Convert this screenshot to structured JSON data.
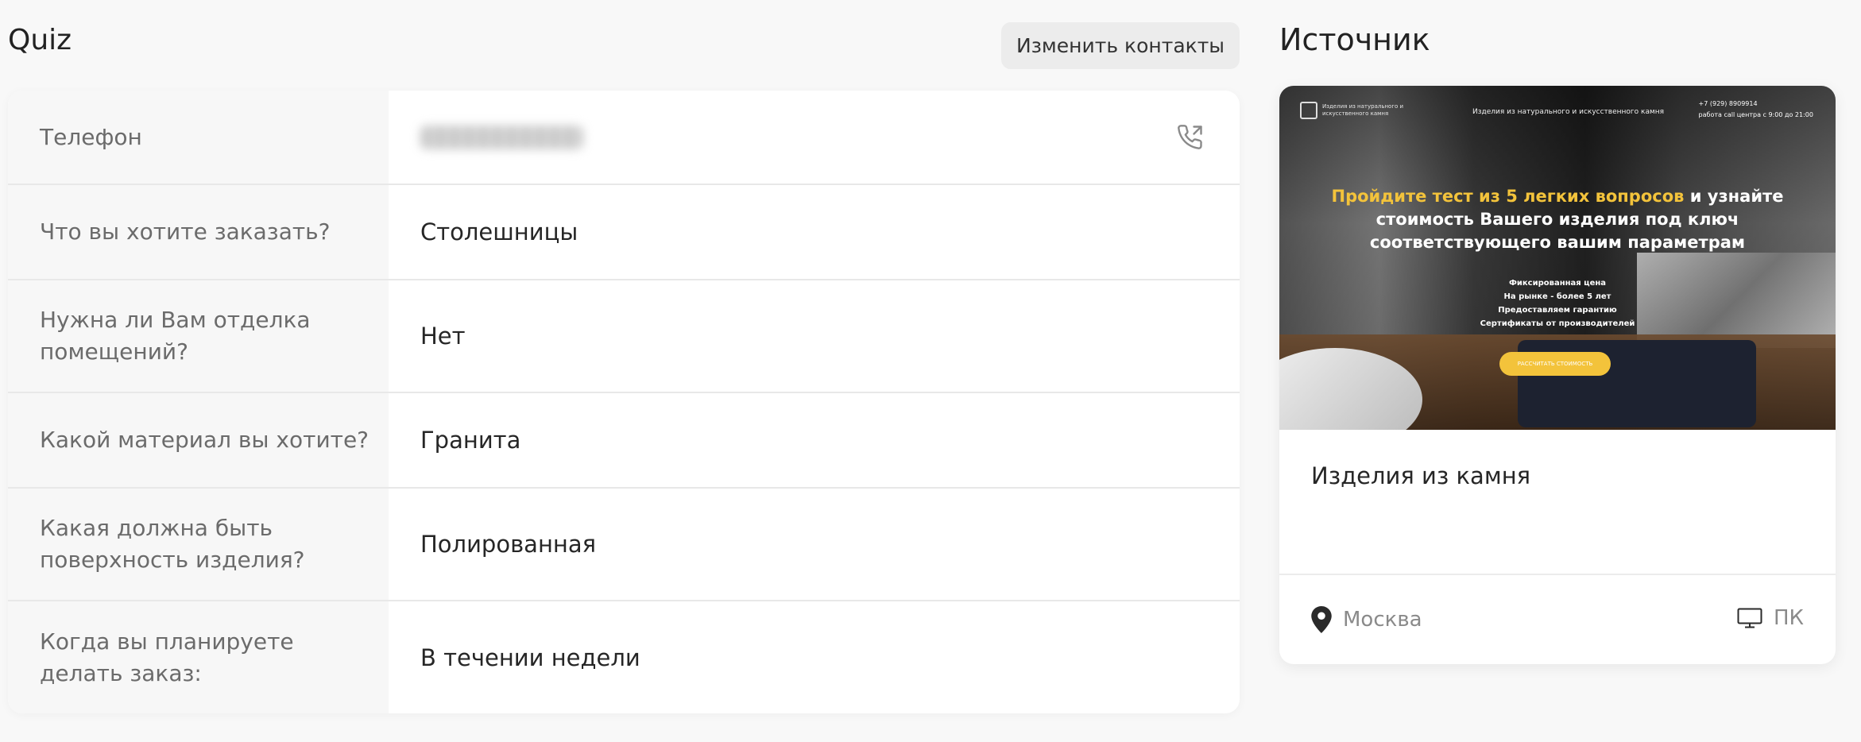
{
  "header": {
    "title": "Quiz",
    "edit_contacts_label": "Изменить контакты"
  },
  "quiz": {
    "rows": [
      {
        "label": "Телефон",
        "value": ""
      },
      {
        "label": "Что вы хотите заказать?",
        "value": "Столешницы"
      },
      {
        "label": "Нужна ли Вам отделка помещений?",
        "value": "Нет"
      },
      {
        "label": "Какой материал вы хотите?",
        "value": "Гранита"
      },
      {
        "label": "Какая должна быть поверхность изделия?",
        "value": "Полированная"
      },
      {
        "label": "Когда вы планируете делать заказ:",
        "value": "В течении недели"
      }
    ]
  },
  "source": {
    "title": "Источник",
    "name": "Изделия из камня",
    "location": "Москва",
    "device": "ПК",
    "preview": {
      "logo_text": "Изделия из натурального и искусственного камня",
      "header_mid": "Изделия из натурального и искусственного камня",
      "phone": "+7 (929) 8909914",
      "hours": "работа call центра с 9:00 до 21:00",
      "headline_highlight": "Пройдите тест из 5 легких вопросов",
      "headline_rest": " и узнайте стоимость Вашего изделия под ключ соответствующего вашим параметрам",
      "bullets": [
        "Фиксированная цена",
        "На рынке - более 5 лет",
        "Предоставляем гарантию",
        "Сертификаты от производителей"
      ],
      "cta": "РАССЧИТАТЬ СТОИМОСТЬ"
    }
  },
  "colors": {
    "accent": "#f3c33b",
    "background": "#f8f8f8",
    "label_bg": "#f7f7f7"
  }
}
